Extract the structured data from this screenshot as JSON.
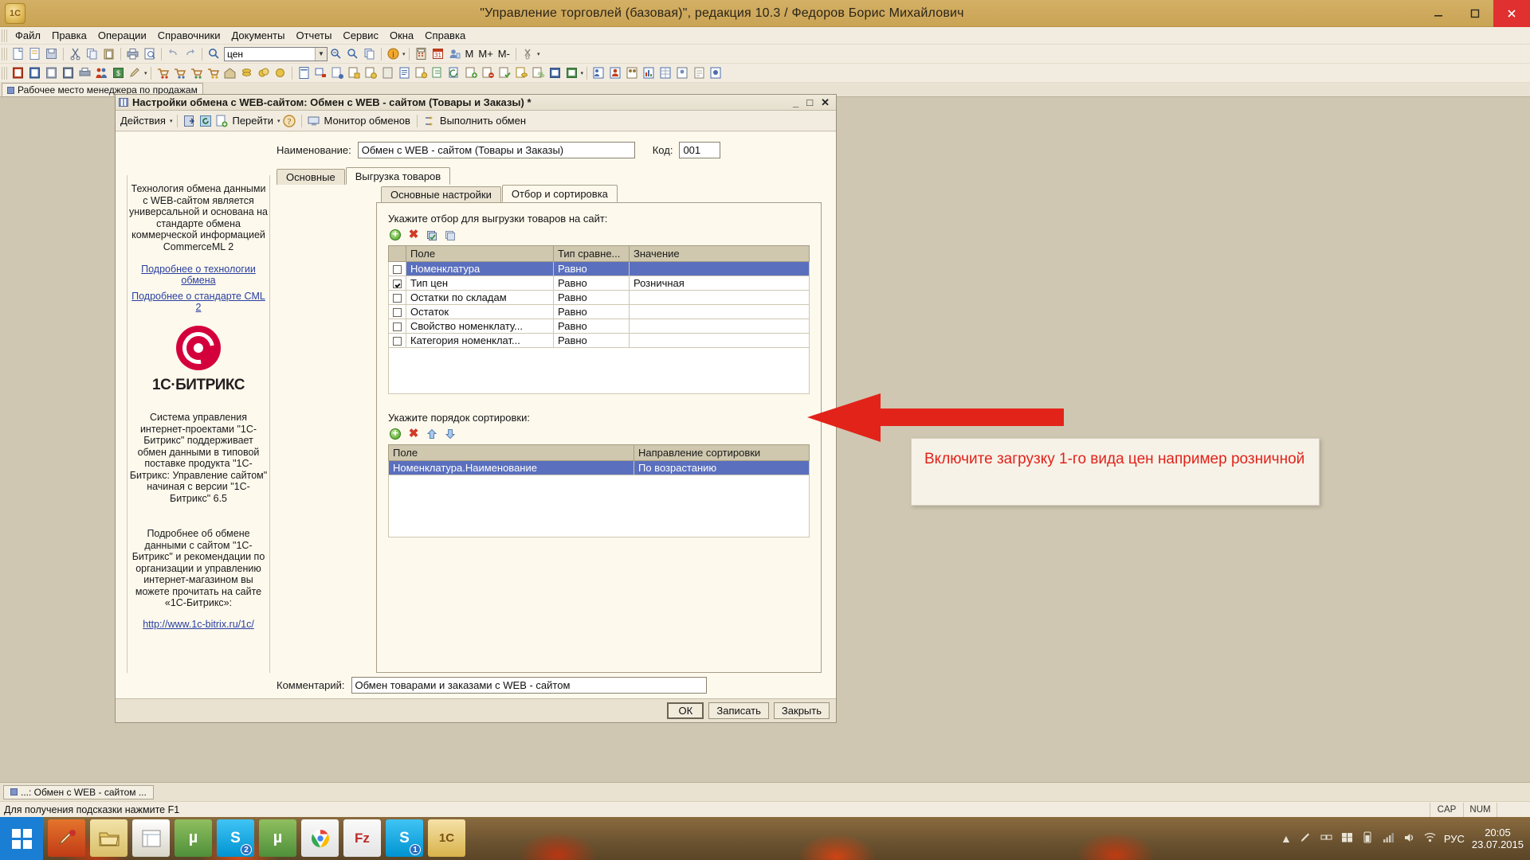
{
  "window": {
    "title": "\"Управление торговлей (базовая)\", редакция 10.3 / Федоров Борис Михайлович",
    "app_icon": "1c-logo-icon",
    "minimize": "minimize-icon",
    "maximize": "maximize-icon",
    "close": "close-icon"
  },
  "menubar": {
    "items": [
      {
        "label": "Файл"
      },
      {
        "label": "Правка"
      },
      {
        "label": "Операции"
      },
      {
        "label": "Справочники"
      },
      {
        "label": "Документы"
      },
      {
        "label": "Отчеты"
      },
      {
        "label": "Сервис"
      },
      {
        "label": "Окна"
      },
      {
        "label": "Справка"
      }
    ]
  },
  "toolbar": {
    "search_value": "цен",
    "search_placeholder": "",
    "m_buttons": [
      "M",
      "M+",
      "M-"
    ]
  },
  "mdi_tabs": [
    {
      "label": "Рабочее место менеджера по продажам"
    }
  ],
  "dialog": {
    "title": "Настройки обмена с WEB-сайтом: Обмен с WEB - сайтом (Товары и Заказы) *",
    "window_buttons": {
      "minimize": "_",
      "maximize": "□",
      "close": "✕"
    },
    "toolbar": {
      "actions": "Действия",
      "goto": "Перейти",
      "monitor": "Монитор обменов",
      "run_exchange": "Выполнить обмен",
      "help": "?"
    },
    "name_label": "Наименование:",
    "name_value": "Обмен с WEB - сайтом (Товары и Заказы)",
    "code_label": "Код:",
    "code_value": "001",
    "tabs_level1": [
      {
        "label": "Основные",
        "active": false
      },
      {
        "label": "Выгрузка товаров",
        "active": true
      }
    ],
    "tabs_level2": [
      {
        "label": "Основные настройки",
        "active": false
      },
      {
        "label": "Отбор и сортировка",
        "active": true
      }
    ],
    "filter_section": {
      "caption": "Укажите отбор для выгрузки товаров на сайт:",
      "toolbar_icons": [
        "add-icon",
        "delete-icon",
        "copy-icon",
        "duplicate-icon"
      ],
      "columns": [
        "",
        "Поле",
        "Тип сравне...",
        "Значение"
      ],
      "rows": [
        {
          "checked": false,
          "field": "Номенклатура",
          "comparison": "Равно",
          "value": "",
          "selected": true
        },
        {
          "checked": true,
          "field": "Тип цен",
          "comparison": "Равно",
          "value": "Розничная",
          "selected": false
        },
        {
          "checked": false,
          "field": "Остатки по складам",
          "comparison": "Равно",
          "value": "",
          "selected": false
        },
        {
          "checked": false,
          "field": "Остаток",
          "comparison": "Равно",
          "value": "",
          "selected": false
        },
        {
          "checked": false,
          "field": "Свойство номенклату...",
          "comparison": "Равно",
          "value": "",
          "selected": false
        },
        {
          "checked": false,
          "field": "Категория номенклат...",
          "comparison": "Равно",
          "value": "",
          "selected": false
        }
      ]
    },
    "sort_section": {
      "caption": "Укажите порядок сортировки:",
      "toolbar_icons": [
        "add-icon",
        "delete-icon",
        "move-up-icon",
        "move-down-icon"
      ],
      "columns": [
        "Поле",
        "Направление сортировки"
      ],
      "rows": [
        {
          "field": "Номенклатура.Наименование",
          "direction": "По возрастанию",
          "selected": true
        }
      ]
    },
    "comment_label": "Комментарий:",
    "comment_value": "Обмен товарами и заказами с WEB - сайтом",
    "buttons": {
      "ok": "ОК",
      "write": "Записать",
      "close": "Закрыть"
    }
  },
  "info_panel": {
    "paragraph1": "Технология обмена данными с WEB-сайтом является универсальной и основана на стандарте обмена коммерческой информацией CommerceML 2",
    "link1": "Подробнее о технологии обмена",
    "link2": "Подробнее о стандарте CML 2",
    "logo_text": "1C·БИТРИКС",
    "paragraph2": "Система управления интернет-проектами \"1С-Битрикс\" поддерживает обмен данными в типовой поставке продукта \"1С-Битрикс: Управление сайтом\" начиная с версии \"1С-Битрикс\" 6.5",
    "paragraph3": "Подробнее об обмене данными с сайтом \"1С-Битрикс\" и рекомендации по организации и управлению интернет-магазином вы можете прочитать на сайте «1С-Битрикс»:",
    "link3": "http://www.1c-bitrix.ru/1c/"
  },
  "annotation": {
    "text": "Включите загрузку 1-го вида цен например розничной",
    "color": "#e2231a",
    "arrow": "left-arrow"
  },
  "app_taskbar": {
    "items": [
      {
        "label": "...: Обмен с WEB - сайтом ..."
      }
    ]
  },
  "statusbar": {
    "hint": "Для получения подсказки нажмите F1",
    "cells": [
      "CAP",
      "NUM"
    ]
  },
  "os_taskbar": {
    "start": "start-button",
    "apps": [
      {
        "name": "paint-icon",
        "glyph": "🖌",
        "color": "#c03b16"
      },
      {
        "name": "explorer-folder-icon",
        "glyph": "🗀",
        "color": "#d8c37a"
      },
      {
        "name": "file-manager-icon",
        "glyph": "▤",
        "color": "#e8e4d8"
      },
      {
        "name": "utorrent-icon",
        "glyph": "µ",
        "color": "#4f9b4f"
      },
      {
        "name": "skype-icon",
        "glyph": "S",
        "color": "#00aff0",
        "badge": "2"
      },
      {
        "name": "utorrent2-icon",
        "glyph": "µ",
        "color": "#5aa84f"
      },
      {
        "name": "chrome-icon",
        "glyph": "◉",
        "color": "#4285f4"
      },
      {
        "name": "filezilla-icon",
        "glyph": "Fz",
        "color": "#bf2a2a"
      },
      {
        "name": "skype2-icon",
        "glyph": "S",
        "color": "#00aff0",
        "badge": "1"
      },
      {
        "name": "1c-icon",
        "glyph": "1C",
        "color": "#e8c56a"
      }
    ],
    "language": "РУС",
    "time": "20:05",
    "date": "23.07.2015"
  }
}
